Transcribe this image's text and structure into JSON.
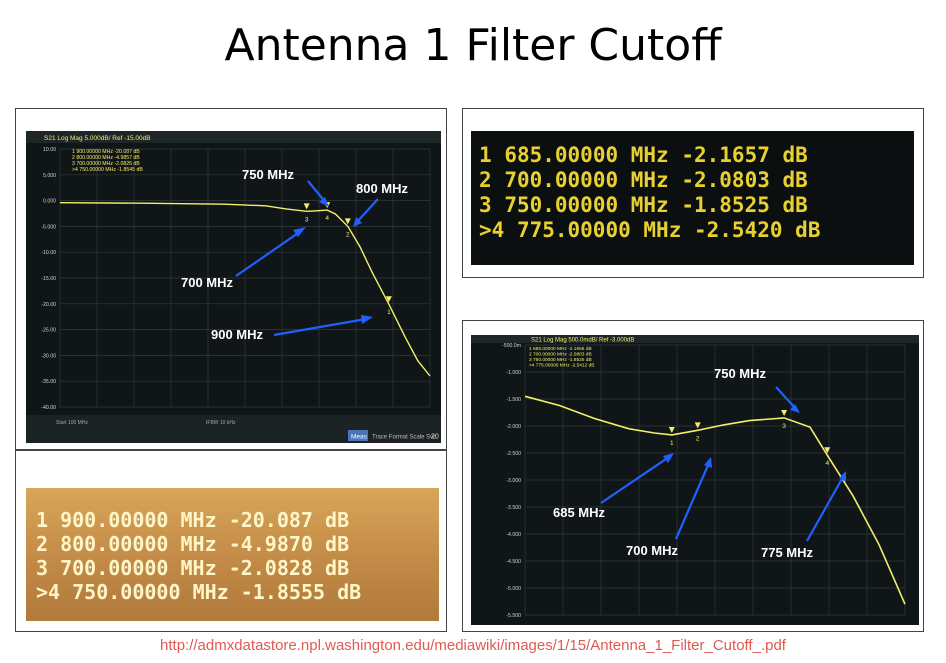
{
  "title": "Antenna 1 Filter Cutoff",
  "source_url": "http://admxdatastore.npl.washington.edu/mediawiki/images/1/15/Antenna_1_Filter_Cutoff_.pdf",
  "colors": {
    "trace": "#f4ee6a",
    "screen": "#0e1315",
    "grid": "#2f3a3c",
    "arrow": "#2060ff",
    "table_text": "#e8d030"
  },
  "top_left_screen": {
    "header": "S21 Log Mag 5.000dB/ Ref -15.00dB",
    "marker_lines": [
      "1  900.00000 MHz -20.087 dB",
      "2  800.00000 MHz -4.9857 dB",
      "3  700.00000 MHz -2.0826 dB",
      ">4  750.00000 MHz -1.8545 dB"
    ],
    "footer_left": "Start 100 MHz",
    "footer_mid": "IFBW 10 kHz",
    "softkey": "Meas",
    "softkey_tabs": "Trace Format Scale Svc",
    "ref_marker": "20"
  },
  "top_left_annotations": [
    {
      "label": "750 MHz"
    },
    {
      "label": "800 MHz"
    },
    {
      "label": "700 MHz"
    },
    {
      "label": "900 MHz"
    }
  ],
  "bottom_right_screen": {
    "header": "S21 Log Mag 500.0mdB/ Ref -3.000dB",
    "marker_lines": [
      "1  685.00000 MHz -2.1656 dB",
      "2  700.00000 MHz -2.0803 dB",
      "3  750.00000 MHz -1.8525 dB",
      ">4  775.00000 MHz -2.5412 dB"
    ]
  },
  "bottom_right_annotations": [
    {
      "label": "750 MHz"
    },
    {
      "label": "685 MHz"
    },
    {
      "label": "700 MHz"
    },
    {
      "label": "775 MHz"
    }
  ],
  "marker_table_top_right": [
    {
      "num": "1",
      "freq": "685.00000",
      "unit": "MHz",
      "value": "-2.1657",
      "db": "dB"
    },
    {
      "num": "2",
      "freq": "700.00000",
      "unit": "MHz",
      "value": "-2.0803",
      "db": "dB"
    },
    {
      "num": "3",
      "freq": "750.00000",
      "unit": "MHz",
      "value": "-1.8525",
      "db": "dB"
    },
    {
      "num": ">4",
      "freq": "775.00000",
      "unit": "MHz",
      "value": "-2.5420",
      "db": "dB"
    }
  ],
  "marker_table_bottom_left": [
    {
      "num": "1",
      "freq": "900.00000",
      "unit": "MHz",
      "value": "-20.087",
      "db": "dB"
    },
    {
      "num": "2",
      "freq": "800.00000",
      "unit": "MHz",
      "value": "-4.9870",
      "db": "dB"
    },
    {
      "num": "3",
      "freq": "700.00000",
      "unit": "MHz",
      "value": "-2.0828",
      "db": "dB"
    },
    {
      "num": ">4",
      "freq": "750.00000",
      "unit": "MHz",
      "value": "-1.8555",
      "db": "dB"
    }
  ],
  "chart_data": [
    {
      "type": "line",
      "title": "S21 Log Mag 5.000dB/ Ref -15.00dB",
      "ylabel": "dB",
      "xlabel": "MHz",
      "ylim": [
        -40,
        10
      ],
      "y_ticks": [
        "10.00",
        "5.000",
        "0.000",
        "-5.000",
        "-10.00",
        "-15.00",
        "-20.00",
        "-25.00",
        "-30.00",
        "-35.00",
        "-40.00"
      ],
      "xlim": [
        100,
        1000
      ],
      "grid": true,
      "series": [
        {
          "x": [
            100,
            300,
            500,
            600,
            650,
            700,
            720,
            750,
            770,
            800,
            830,
            860,
            900,
            940,
            970,
            1000
          ],
          "y": [
            -0.4,
            -0.5,
            -0.7,
            -1.0,
            -1.6,
            -2.08,
            -2.0,
            -1.85,
            -2.6,
            -4.99,
            -9.0,
            -14.0,
            -20.09,
            -26.5,
            -31.0,
            -34.0
          ]
        }
      ],
      "markers": [
        {
          "id": "1",
          "x": 900,
          "y": -20.087
        },
        {
          "id": "2",
          "x": 800,
          "y": -4.9857
        },
        {
          "id": "3",
          "x": 700,
          "y": -2.0826
        },
        {
          "id": "4",
          "x": 750,
          "y": -1.8545
        }
      ]
    },
    {
      "type": "line",
      "title": "S21 Log Mag 500.0mdB/ Ref -3.000dB",
      "ylabel": "dB",
      "xlabel": "MHz",
      "ylim": [
        -5.5,
        -0.5
      ],
      "y_ticks": [
        "-500.0m",
        "-1.000",
        "-1.500",
        "-2.000",
        "-2.500",
        "-3.000",
        "-3.500",
        "-4.000",
        "-4.500",
        "-5.000",
        "-5.500"
      ],
      "xlim": [
        600,
        820
      ],
      "grid": true,
      "series": [
        {
          "x": [
            600,
            620,
            640,
            660,
            675,
            685,
            700,
            715,
            730,
            750,
            765,
            775,
            790,
            805,
            820
          ],
          "y": [
            -1.45,
            -1.62,
            -1.86,
            -2.05,
            -2.13,
            -2.1656,
            -2.08,
            -1.98,
            -1.9,
            -1.85,
            -2.02,
            -2.5412,
            -3.3,
            -4.2,
            -5.3
          ]
        }
      ],
      "markers": [
        {
          "id": "1",
          "x": 685,
          "y": -2.1656
        },
        {
          "id": "2",
          "x": 700,
          "y": -2.0803
        },
        {
          "id": "3",
          "x": 750,
          "y": -1.8525
        },
        {
          "id": "4",
          "x": 775,
          "y": -2.5412
        }
      ]
    }
  ]
}
